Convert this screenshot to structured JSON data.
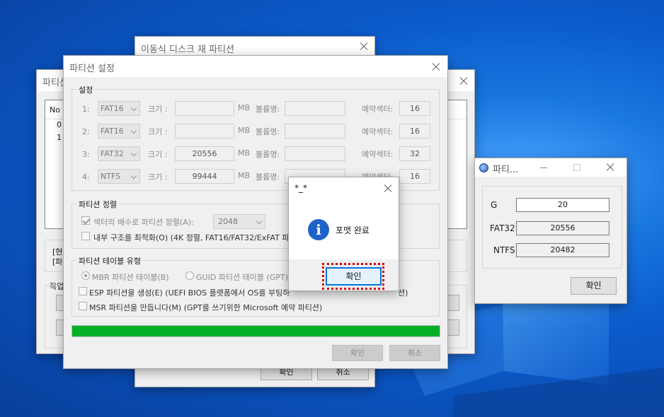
{
  "back_window": {
    "title": "이동식 디스크 재 파티션",
    "ok_label": "확인",
    "cancel_label": "취소"
  },
  "left_window": {
    "title": "파티션",
    "col_no": "No",
    "rows": [
      "0",
      "1"
    ],
    "info_lines": [
      "[현",
      "[파"
    ],
    "work_label": "작업"
  },
  "main_dialog": {
    "title": "파티션 설정",
    "settings_group": "설정",
    "partitions": [
      {
        "index": "1:",
        "fs": "FAT16",
        "size_label": "크기 :",
        "size": "",
        "unit": "MB",
        "vol_label": "볼륨명:",
        "volume": "",
        "reserved_label": "예약섹터:",
        "reserved": "16"
      },
      {
        "index": "2:",
        "fs": "FAT16",
        "size_label": "크기 :",
        "size": "",
        "unit": "MB",
        "vol_label": "볼륨명:",
        "volume": "",
        "reserved_label": "예약섹터:",
        "reserved": "16"
      },
      {
        "index": "3:",
        "fs": "FAT32",
        "size_label": "크기 :",
        "size": "20556",
        "unit": "MB",
        "vol_label": "볼륨명:",
        "volume": "",
        "reserved_label": "예약섹터:",
        "reserved": "32"
      },
      {
        "index": "4:",
        "fs": "NTFS",
        "size_label": "크기 :",
        "size": "99444",
        "unit": "MB",
        "vol_label": "볼륨명:",
        "volume": "",
        "reserved_label": "예약섹터:",
        "reserved": "16"
      }
    ],
    "align_group": "파티션 정렬",
    "align_checkbox": "섹터의 배수로 파티션 정렬(A):",
    "align_value": "2048",
    "optimize_checkbox": "내부 구조를 최적화(O) (4K 정렬, FAT16/FAT32/ExFAT 파",
    "table_group": "파티션 테이블 유형",
    "mbr_radio": "MBR 파티션 테이블(B)",
    "gpt_radio": "GUID 파티션 테이블 (GPT)(",
    "esp_checkbox": "ESP 파티션을 생성(E) (UEFI BIOS 플랫폼에서 OS를 부팅하",
    "esp_tail": "션)",
    "msr_checkbox": "MSR 파티션을 만듭니다(M) (GPT를 쓰기위한 Microsoft 예약 파티션)",
    "progress": 1.0,
    "progress_color": "#06b025",
    "ok_label": "확인",
    "cancel_label": "취소"
  },
  "message_box": {
    "title": "*_*",
    "message": "포맷 완료",
    "ok_label": "확인"
  },
  "right_window": {
    "title": "파티...",
    "rows": [
      {
        "label": "G",
        "value": "20"
      },
      {
        "label": "FAT32",
        "value": "20556"
      },
      {
        "label": "NTFS",
        "value": "20482"
      }
    ],
    "ok_label": "확인"
  }
}
